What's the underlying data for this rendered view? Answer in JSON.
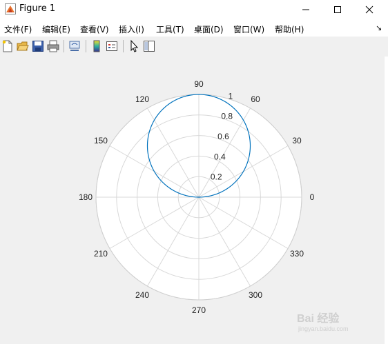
{
  "window": {
    "title": "Figure 1",
    "minimize_glyph": "—",
    "maximize_glyph": "☐",
    "close_glyph": "✕"
  },
  "menu": {
    "items": [
      "文件(F)",
      "编辑(E)",
      "查看(V)",
      "插入(I)",
      "工具(T)",
      "桌面(D)",
      "窗口(W)",
      "帮助(H)"
    ],
    "overflow_glyph": "↘"
  },
  "toolbar": {
    "buttons": [
      "new-figure-icon",
      "open-folder-icon",
      "save-icon",
      "print-icon",
      "link-plot-icon",
      "colorbar-icon",
      "legend-icon",
      "pointer-icon",
      "property-editor-icon"
    ]
  },
  "colors": {
    "curve": "#0072BD",
    "grid": "#d8d8d8",
    "axes_bg": "#ffffff",
    "figure_bg": "#f0f0f0"
  },
  "chart_data": {
    "type": "polar-line",
    "theta_ticks": [
      "0",
      "30",
      "60",
      "90",
      "120",
      "150",
      "180",
      "210",
      "240",
      "270",
      "300",
      "330"
    ],
    "r_ticks": [
      "0.2",
      "0.4",
      "0.6",
      "0.8",
      "1"
    ],
    "rlim": [
      0,
      1
    ],
    "grid": true,
    "series": [
      {
        "equation_samples_theta_deg": [
          0,
          30,
          60,
          90,
          120,
          150,
          180
        ],
        "r": [
          0,
          0.5,
          0.866,
          1,
          0.866,
          0.5,
          0
        ]
      }
    ]
  },
  "watermark": {
    "text": "Bai 经验",
    "sub": "jingyan.baidu.com"
  }
}
